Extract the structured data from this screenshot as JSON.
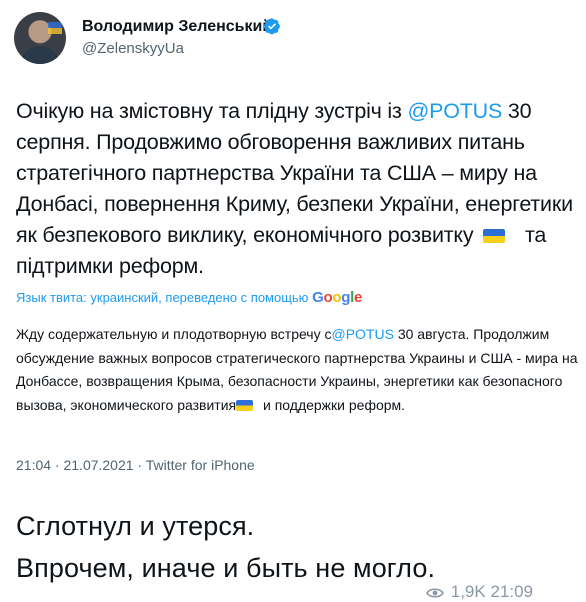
{
  "author": {
    "name": "Володимир Зеленський",
    "handle": "@ZelenskyyUa"
  },
  "tweet": {
    "part1": "Очікую на змістовну та плідну зустріч із ",
    "mention": "@POTUS",
    "part2": " 30 серпня. Продовжимо обговорення важливих питань стратегічного партнерства України та США – миру на Донбасі, повернення Криму, безпеки України, енергетики як безпекового виклику, економічного розвитку ",
    "part3": " та підтримки реформ."
  },
  "translation_notice": {
    "text": "Язык твита: украинский, переведено с помощью",
    "google": [
      "G",
      "o",
      "o",
      "g",
      "l",
      "e"
    ]
  },
  "translation": {
    "part1": "Жду содержательную и плодотворную встречу с",
    "mention": "@POTUS",
    "part2": " 30 августа. Продолжим обсуждение важных вопросов стратегического партнерства Украины и США - мира на Донбассе, возвращения Крыма, безопасности Украины, энергетики как безопасного вызова, экономического развития",
    "part3": " и поддержки реформ."
  },
  "meta": "21:04 · 21.07.2021 · Twitter for iPhone",
  "caption": {
    "line1": "Сглотнул и утерся.",
    "line2": "Впрочем, иначе и быть не могло."
  },
  "stats": {
    "views": "1,9K",
    "time": "21:09"
  },
  "colors": {
    "link": "#1d9bf0",
    "muted": "#536471",
    "flag_blue": "#2c6ed5",
    "flag_yellow": "#f5cf1a"
  }
}
